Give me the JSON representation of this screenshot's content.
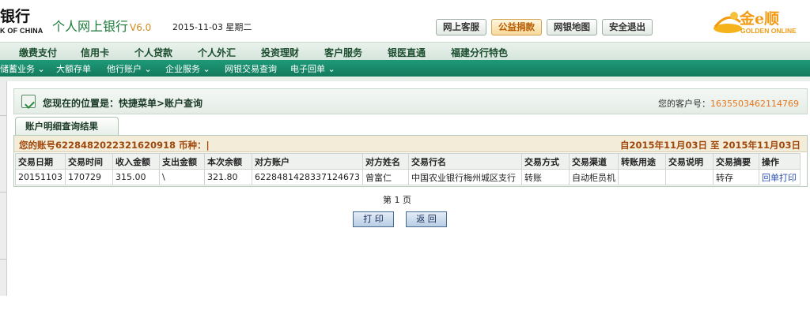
{
  "header": {
    "logo_cn": "银行",
    "logo_en": "K OF CHINA",
    "title": "个人网上银行",
    "version": "V6.0",
    "date": "2015-11-03 星期二",
    "buttons": [
      "网上客服",
      "公益捐款",
      "网银地图",
      "安全退出"
    ],
    "active_button": "公益捐款",
    "brand_cn": "金e顺",
    "brand_en": "GOLDEN ONLINE"
  },
  "nav_main": [
    "缴费支付",
    "信用卡",
    "个人贷款",
    "个人外汇",
    "投资理财",
    "客户服务",
    "银医直通",
    "福建分行特色"
  ],
  "nav_sub": [
    "储蓄业务 ⌄",
    "大额存单",
    "他行账户 ⌄",
    "企业服务 ⌄",
    "网银交易查询",
    "电子回单 ⌄"
  ],
  "location": {
    "label": "您现在的位置是：快捷菜单>账户查询",
    "customer_label": "您的客户号：",
    "customer_no": "1635503462114769"
  },
  "tab_label": "账户明细查询结果",
  "account": {
    "label": "您的账号6228482022321620918 币种：|",
    "range": "自2015年11月03日 至 2015年11月03日"
  },
  "table": {
    "headers": [
      "交易日期",
      "交易时间",
      "收入金额",
      "支出金额",
      "本次余额",
      "对方账户",
      "对方姓名",
      "交易行名",
      "交易方式",
      "交易渠道",
      "转账用途",
      "交易说明",
      "交易摘要",
      "操作"
    ],
    "rows": [
      [
        "20151103",
        "170729",
        "315.00",
        "\\",
        "321.80",
        "6228481428337124673",
        "曾富仁",
        "中国农业银行梅州城区支行",
        "转账",
        "自动柜员机",
        "",
        "",
        "转存",
        "回单打印"
      ]
    ]
  },
  "pagination": "第 1 页",
  "buttons": {
    "print": "打 印",
    "back": "返 回"
  }
}
